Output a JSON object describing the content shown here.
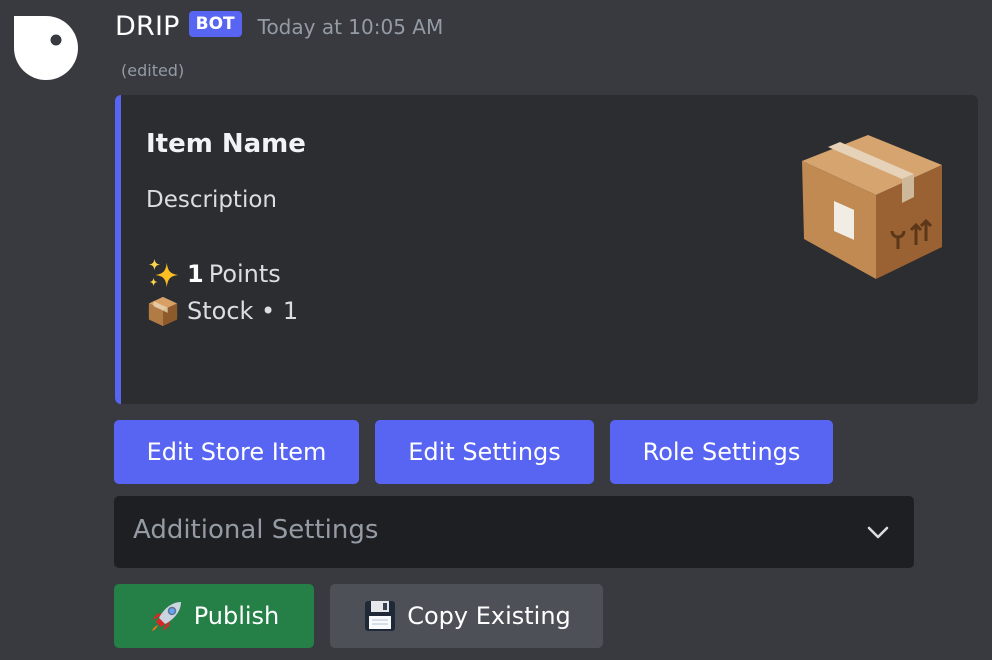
{
  "message": {
    "author": "DRIP",
    "badge": "BOT",
    "timestamp": "Today at 10:05 AM",
    "edited_label": "(edited)"
  },
  "embed": {
    "accent_color": "#5865f2",
    "title": "Item Name",
    "description": "Description",
    "points": {
      "icon": "sparkles-icon",
      "value": "1",
      "label": "Points"
    },
    "stock": {
      "icon": "package-icon",
      "text": "Stock • 1"
    },
    "thumbnail": "package-icon"
  },
  "buttons": {
    "edit_store_item": "Edit Store Item",
    "edit_settings": "Edit Settings",
    "role_settings": "Role Settings",
    "publish": "Publish",
    "publish_icon": "rocket-icon",
    "copy_existing": "Copy Existing",
    "copy_existing_icon": "floppy-disk-icon"
  },
  "select": {
    "placeholder": "Additional Settings",
    "icon": "chevron-down-icon"
  },
  "colors": {
    "background": "#383a40",
    "embed_bg": "#2b2d31",
    "blurple": "#5865f2",
    "green": "#248046",
    "grey": "#4e5058",
    "select_bg": "#1e1f22"
  }
}
